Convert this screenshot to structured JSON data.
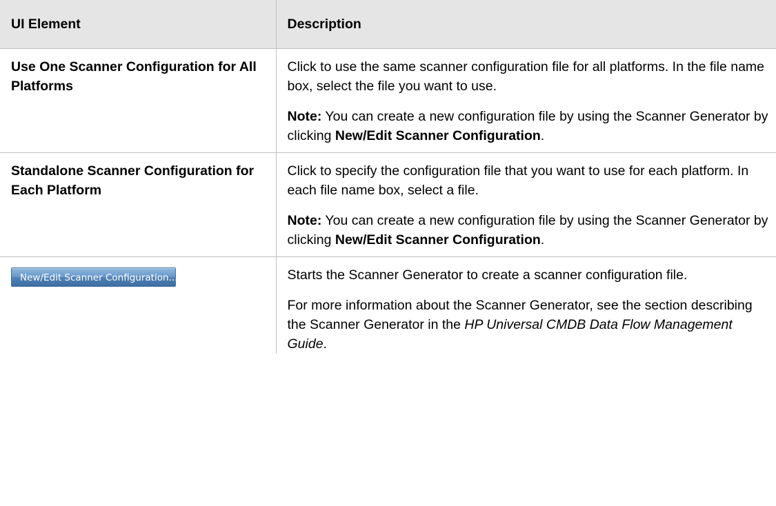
{
  "table": {
    "headers": {
      "ui_element": "UI Element",
      "description": "Description"
    },
    "rows": [
      {
        "element": "Use One Scanner Configuration for All Platforms",
        "desc1": "Click to use the same scanner configuration file for all platforms. In the file name box, select the file you want to use.",
        "note_label": "Note:",
        "note_text": " You can create a new configuration file by using the Scanner Generator by clicking ",
        "note_bold": "New/Edit Scanner Configuration",
        "note_end": "."
      },
      {
        "element": "Standalone Scanner Configuration for Each Platform",
        "desc1": "Click to specify the configuration file that you want to use for each platform. In each file name box, select a file.",
        "note_label": "Note:",
        "note_text": " You can create a new configuration file by using the Scanner Generator by clicking ",
        "note_bold": "New/Edit Scanner Configuration",
        "note_end": "."
      },
      {
        "button_label": "New/Edit Scanner Configuration...",
        "desc1": "Starts the Scanner Generator to create a scanner configuration file.",
        "desc2_start": "For more information about the Scanner Generator, see the section describing the Scanner Generator in the ",
        "desc2_italic": "HP Universal CMDB Data Flow Management Guide",
        "desc2_end": "."
      }
    ]
  },
  "colors": {
    "header_background": "#e5e5e5",
    "border": "#bfbfbf",
    "button_top": "#8fb7df",
    "button_bottom": "#3d6fa3"
  }
}
